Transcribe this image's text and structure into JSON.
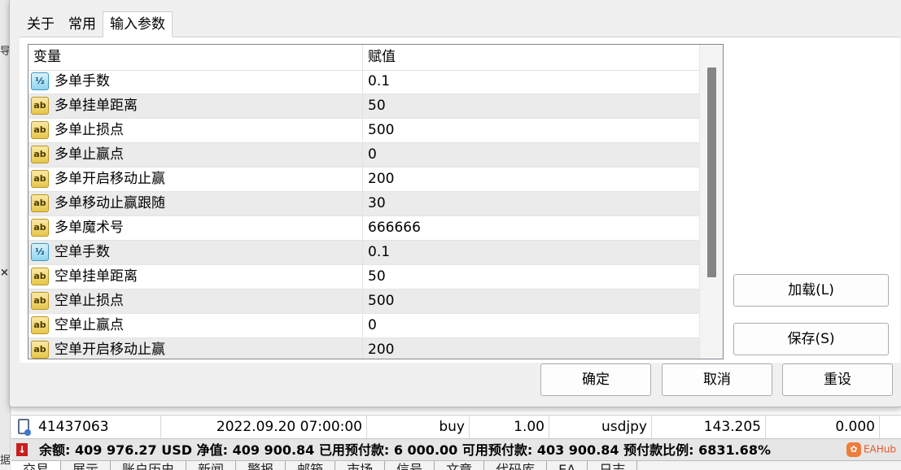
{
  "dialog": {
    "tabs": [
      {
        "label": "关于",
        "active": false
      },
      {
        "label": "常用",
        "active": false
      },
      {
        "label": "输入参数",
        "active": true
      }
    ],
    "grid": {
      "columns": [
        "变量",
        "赋值"
      ],
      "rows": [
        {
          "icon": "half-icon",
          "name": "多单手数",
          "value": "0.1"
        },
        {
          "icon": "ab-icon",
          "name": "多单挂单距离",
          "value": "50"
        },
        {
          "icon": "ab-icon",
          "name": "多单止损点",
          "value": "500"
        },
        {
          "icon": "ab-icon",
          "name": "多单止赢点",
          "value": "0"
        },
        {
          "icon": "ab-icon",
          "name": "多单开启移动止赢",
          "value": "200"
        },
        {
          "icon": "ab-icon",
          "name": "多单移动止赢跟随",
          "value": "30"
        },
        {
          "icon": "ab-icon",
          "name": "多单魔术号",
          "value": "666666"
        },
        {
          "icon": "half-icon",
          "name": "空单手数",
          "value": "0.1"
        },
        {
          "icon": "ab-icon",
          "name": "空单挂单距离",
          "value": "50"
        },
        {
          "icon": "ab-icon",
          "name": "空单止损点",
          "value": "500"
        },
        {
          "icon": "ab-icon",
          "name": "空单止赢点",
          "value": "0"
        },
        {
          "icon": "ab-icon",
          "name": "空单开启移动止赢",
          "value": "200"
        }
      ],
      "icon_glyphs": {
        "ab": "ab",
        "half": "½"
      }
    },
    "buttons": {
      "load": "加载(L)",
      "save": "保存(S)",
      "ok": "确定",
      "cancel": "取消",
      "reset": "重设"
    }
  },
  "terminal": {
    "order_row": {
      "ticket": "41437063",
      "time": "2022.09.20 07:00:00",
      "type": "buy",
      "volume": "1.00",
      "symbol": "usdjpy",
      "price": "143.205",
      "sl": "0.000"
    },
    "summary": "余额: 409 976.27 USD  净值: 409 900.84  已用预付款: 6 000.00  可用预付款: 403 900.84  预付款比例: 6831.68%",
    "logo_text": "EAHub",
    "bottom_tabs": [
      "交易",
      "展示",
      "账户历史",
      "新闻",
      "警报",
      "邮箱",
      "市场",
      "信号",
      "文章",
      "代码库",
      "EA",
      "日志"
    ]
  },
  "colors": {
    "ab_icon": "#e7c64a",
    "half_icon": "#8fd4ef",
    "summary_arrow": "#c81e1e",
    "row_alt": "#ebebeb"
  }
}
